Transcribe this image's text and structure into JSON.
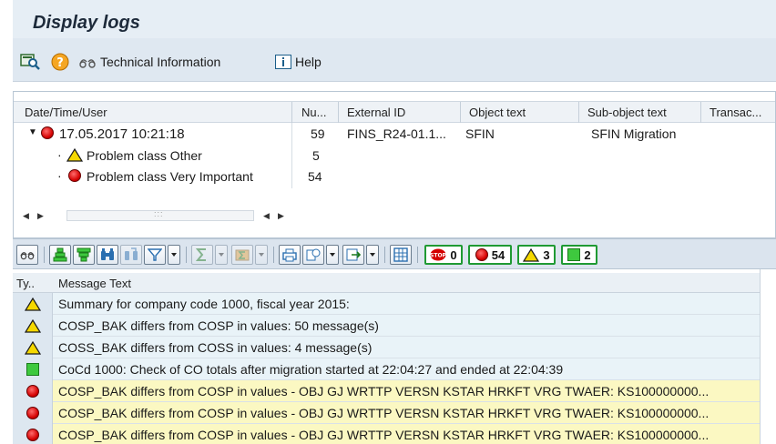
{
  "window": {
    "title": "Display logs"
  },
  "app_toolbar": {
    "technical_information_label": "Technical Information",
    "help_label": "Help"
  },
  "tree": {
    "columns": [
      "Date/Time/User",
      "Nu...",
      "External ID",
      "Object text",
      "Sub-object text",
      "Transac..."
    ],
    "rows": [
      {
        "label": "17.05.2017  10:21:18",
        "number": "59",
        "external_id": "FINS_R24-01.1...",
        "object_text": "SFIN",
        "sub_object_text": "SFIN Migration",
        "status": "error",
        "expanded": true
      },
      {
        "label": "Problem class Other",
        "number": "5",
        "status": "warning"
      },
      {
        "label": "Problem class Very Important",
        "number": "54",
        "status": "error"
      }
    ]
  },
  "grid_toolbar": {
    "counts": {
      "stop": "0",
      "error": "54",
      "warning": "3",
      "success": "2"
    }
  },
  "grid": {
    "columns": [
      "Ty..",
      "Message Text"
    ],
    "rows": [
      {
        "type": "warning",
        "text": "Summary for company code 1000, fiscal year 2015:"
      },
      {
        "type": "warning",
        "text": "COSP_BAK differs from COSP in values: 50 message(s)"
      },
      {
        "type": "warning",
        "text": "COSS_BAK differs from COSS in values: 4 message(s)"
      },
      {
        "type": "success",
        "text": "CoCd 1000: Check of CO totals after migration started at 22:04:27 and ended at 22:04:39"
      },
      {
        "type": "error",
        "text": "COSP_BAK differs from COSP in values - OBJ GJ WRTTP VERSN KSTAR HRKFT VRG TWAER: KS100000000..."
      },
      {
        "type": "error",
        "text": "COSP_BAK differs from COSP in values - OBJ GJ WRTTP VERSN KSTAR HRKFT VRG TWAER: KS100000000..."
      },
      {
        "type": "error",
        "text": "COSP_BAK differs from COSP in values - OBJ GJ WRTTP VERSN KSTAR HRKFT VRG TWAER: KS100000000..."
      }
    ]
  },
  "colors": {
    "warning": "#f5d800",
    "error": "#d40000",
    "success": "#3ec93e",
    "error_row": "#fbf8c2"
  }
}
